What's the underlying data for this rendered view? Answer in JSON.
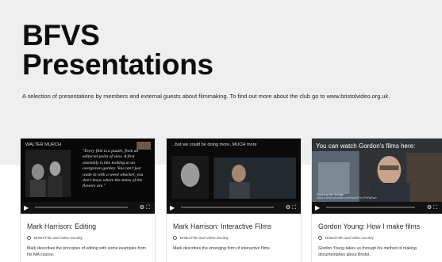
{
  "hero": {
    "title_line1": "BFVS",
    "title_line2": "Presentations",
    "description": "A selection of presentations by members and external guests about filmmaking. To find out more about the club go to www.bristolvideo.org.uk."
  },
  "cards": [
    {
      "title": "Mark Harrison: Editing",
      "org": "Bristol Film and Video Society",
      "description": "Mark describes the principles of editing with some examples from his MA course.",
      "video_overlay": "WALTER MURCH",
      "video_quote": "\"Every film is a puzzle, from an editorial point of view. A first assembly is like looking at an overgrown garden. You can't just wade in with a weed whacker, you don't know where the stems of the flowers are.\"",
      "progress": 0.0
    },
    {
      "title": "Mark Harrison: Interactive Films",
      "org": "Bristol Film and Video Society",
      "description": "Mark describes the emerging form of interactive films.",
      "video_overlay": "...but we could be doing more, MUCH more",
      "progress": 0.0
    },
    {
      "title": "Gordon Young: How I make films",
      "org": "Bristol Film and Video Society",
      "description": "Gordon Young takes us through his method of making documentaries about Bristol.",
      "video_overlay": "You can watch Gordon's films here:",
      "video_sub": "Draining the Bridge",
      "video_url": "https://www.youtube.com/watch?v=PcFqEwo",
      "progress": 0.0
    }
  ],
  "colors": {
    "hero_bg": "#efefef",
    "player_accent": "#1ab7ea"
  }
}
